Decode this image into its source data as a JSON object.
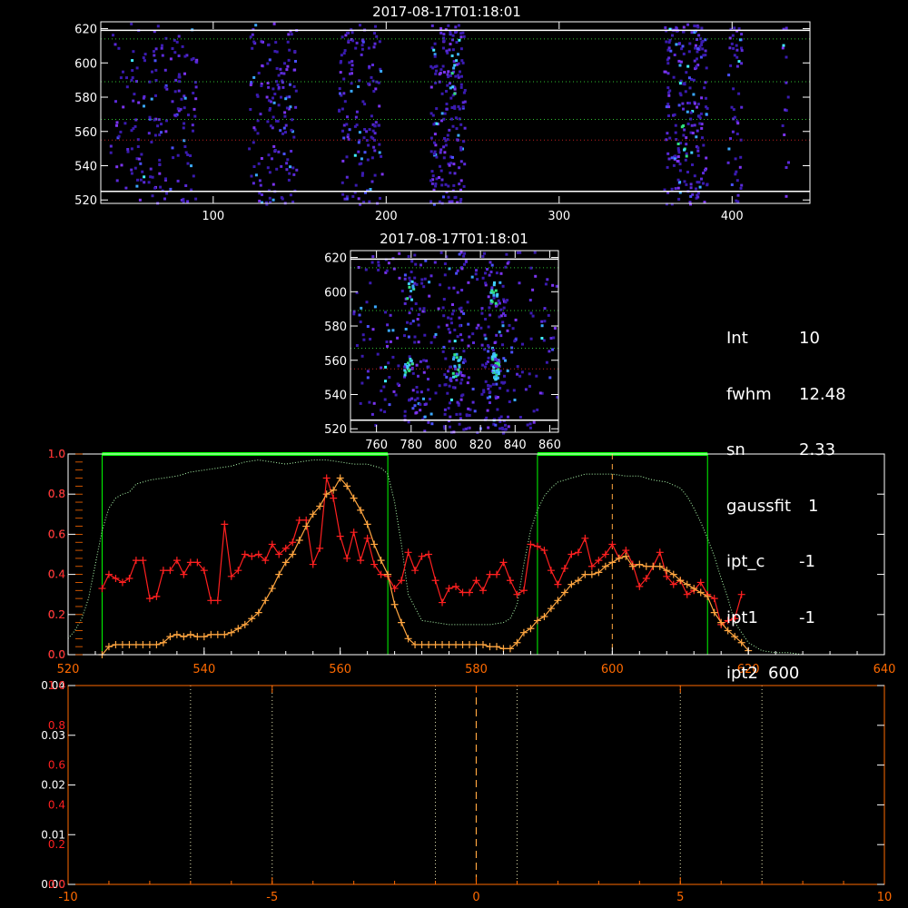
{
  "panels": {
    "top": {
      "title": "2017-08-17T01:18:01",
      "xlim": [
        35,
        445
      ],
      "ylim": [
        518,
        624
      ],
      "xticks": [
        "100",
        "200",
        "300",
        "400"
      ],
      "yticks": [
        "520",
        "540",
        "560",
        "580",
        "600",
        "620"
      ],
      "dotted_lines_y": [
        614,
        589,
        567
      ],
      "red_dotted_line_y": 555,
      "white_lines_y": [
        619,
        525
      ]
    },
    "mid": {
      "title": "2017-08-17T01:18:01",
      "xlim": [
        745,
        865
      ],
      "ylim": [
        518,
        624
      ],
      "xticks": [
        "760",
        "780",
        "800",
        "820",
        "840",
        "860"
      ],
      "yticks": [
        "520",
        "540",
        "560",
        "580",
        "600",
        "620"
      ],
      "dotted_lines_y": [
        614,
        589,
        567
      ],
      "red_dotted_line_y": 555,
      "white_lines_y": [
        619,
        525
      ]
    }
  },
  "info": [
    {
      "key": "Int",
      "value": "10"
    },
    {
      "key": "fwhm",
      "value": "12.48"
    },
    {
      "key": "sn",
      "value": "2.33"
    },
    {
      "key": "gaussfit",
      "value": "1"
    },
    {
      "key": "ipt_c",
      "value": "-1"
    },
    {
      "key": "ipt1",
      "value": "-1"
    },
    {
      "key": "ipt2",
      "value": "600"
    }
  ],
  "colors": {
    "red": "#ff2020",
    "orange": "#ffa640",
    "green": "#00ff00",
    "axis_orange": "#ff6a00",
    "cyan": "#40f0ff",
    "purple": "#5a2ad8"
  },
  "chart_data": [
    {
      "type": "line",
      "xlim": [
        520,
        640
      ],
      "ylim": [
        0,
        1.0
      ],
      "xticks": [
        "520",
        "540",
        "560",
        "580",
        "600",
        "620",
        "640"
      ],
      "yticks_left_white": [
        "0.0",
        "0.2",
        "0.4",
        "0.6",
        "0.8",
        "1.0"
      ],
      "yticks_left_red": [
        "0.0",
        "0.2",
        "0.4",
        "0.6",
        "0.8",
        "1.0"
      ],
      "green_windows": [
        [
          525,
          567
        ],
        [
          589,
          614
        ]
      ],
      "dashed_line_x": 600,
      "series": [
        {
          "x": [
            525,
            526,
            527,
            528,
            529,
            530,
            531,
            532,
            533,
            534,
            535,
            536,
            537,
            538,
            539,
            540,
            541,
            542,
            543,
            544,
            545,
            546,
            547,
            548,
            549,
            550,
            551,
            552,
            553,
            554,
            555,
            556,
            557,
            558,
            559,
            560,
            561,
            562,
            563,
            564,
            565,
            566,
            567,
            568,
            569,
            570,
            571,
            572,
            573,
            574,
            575,
            576,
            577,
            578,
            579,
            580,
            581,
            582,
            583,
            584,
            585,
            586,
            587,
            588,
            589,
            590,
            591,
            592,
            593,
            594,
            595,
            596,
            597,
            598,
            599,
            600,
            601,
            602,
            603,
            604,
            605,
            606,
            607,
            608,
            609,
            610,
            611,
            612,
            613,
            614,
            615,
            616,
            617,
            618,
            619
          ],
          "y": [
            0.33,
            0.4,
            0.38,
            0.36,
            0.38,
            0.47,
            0.47,
            0.28,
            0.29,
            0.42,
            0.42,
            0.47,
            0.4,
            0.46,
            0.46,
            0.42,
            0.27,
            0.27,
            0.65,
            0.39,
            0.42,
            0.5,
            0.49,
            0.5,
            0.47,
            0.55,
            0.5,
            0.53,
            0.56,
            0.67,
            0.67,
            0.45,
            0.53,
            0.88,
            0.78,
            0.59,
            0.48,
            0.61,
            0.47,
            0.58,
            0.45,
            0.4,
            0.39,
            0.33,
            0.37,
            0.51,
            0.42,
            0.49,
            0.5,
            0.37,
            0.26,
            0.33,
            0.34,
            0.31,
            0.31,
            0.37,
            0.32,
            0.4,
            0.4,
            0.46,
            0.37,
            0.3,
            0.32,
            0.55,
            0.54,
            0.52,
            0.42,
            0.35,
            0.43,
            0.5,
            0.51,
            0.58,
            0.44,
            0.47,
            0.5,
            0.55,
            0.48,
            0.52,
            0.45,
            0.34,
            0.38,
            0.44,
            0.51,
            0.39,
            0.35,
            0.37,
            0.3,
            0.32,
            0.36,
            0.3,
            0.28,
            0.15,
            0.17,
            0.18,
            0.3
          ]
        },
        {
          "x": [
            525,
            526,
            527,
            528,
            529,
            530,
            531,
            532,
            533,
            534,
            535,
            536,
            537,
            538,
            539,
            540,
            541,
            542,
            543,
            544,
            545,
            546,
            547,
            548,
            549,
            550,
            551,
            552,
            553,
            554,
            555,
            556,
            557,
            558,
            559,
            560,
            561,
            562,
            563,
            564,
            565,
            566,
            567,
            568,
            569,
            570,
            571,
            572,
            573,
            574,
            575,
            576,
            577,
            578,
            579,
            580,
            581,
            582,
            583,
            584,
            585,
            586,
            587,
            588,
            589,
            590,
            591,
            592,
            593,
            594,
            595,
            596,
            597,
            598,
            599,
            600,
            601,
            602,
            603,
            604,
            605,
            606,
            607,
            608,
            609,
            610,
            611,
            612,
            613,
            614,
            615,
            616,
            617,
            618,
            619,
            620
          ],
          "y": [
            0.0,
            0.04,
            0.05,
            0.05,
            0.05,
            0.05,
            0.05,
            0.05,
            0.05,
            0.06,
            0.09,
            0.1,
            0.09,
            0.1,
            0.09,
            0.09,
            0.1,
            0.1,
            0.1,
            0.11,
            0.13,
            0.15,
            0.18,
            0.21,
            0.27,
            0.33,
            0.4,
            0.46,
            0.5,
            0.57,
            0.64,
            0.7,
            0.74,
            0.8,
            0.82,
            0.88,
            0.84,
            0.78,
            0.72,
            0.65,
            0.55,
            0.47,
            0.4,
            0.25,
            0.16,
            0.08,
            0.05,
            0.05,
            0.05,
            0.05,
            0.05,
            0.05,
            0.05,
            0.05,
            0.05,
            0.05,
            0.05,
            0.04,
            0.04,
            0.03,
            0.03,
            0.06,
            0.11,
            0.13,
            0.17,
            0.19,
            0.23,
            0.27,
            0.31,
            0.35,
            0.37,
            0.4,
            0.4,
            0.41,
            0.44,
            0.46,
            0.48,
            0.49,
            0.44,
            0.45,
            0.44,
            0.44,
            0.44,
            0.42,
            0.4,
            0.37,
            0.35,
            0.33,
            0.31,
            0.29,
            0.21,
            0.16,
            0.12,
            0.09,
            0.06,
            0.02
          ]
        },
        {
          "x": [
            520,
            521,
            522,
            523,
            524,
            525,
            526,
            527,
            528,
            529,
            530,
            532,
            534,
            536,
            538,
            540,
            542,
            544,
            546,
            548,
            550,
            552,
            554,
            556,
            558,
            560,
            562,
            564,
            566,
            567,
            568,
            569,
            570,
            572,
            574,
            576,
            578,
            580,
            582,
            584,
            585,
            586,
            587,
            588,
            589,
            590,
            591,
            592,
            594,
            596,
            598,
            600,
            602,
            604,
            606,
            608,
            610,
            611,
            612,
            613,
            614,
            615,
            616,
            617,
            618,
            620,
            622,
            624,
            626,
            628,
            630,
            632,
            634,
            636,
            638,
            640
          ],
          "y": [
            0.08,
            0.12,
            0.18,
            0.28,
            0.45,
            0.62,
            0.73,
            0.78,
            0.8,
            0.81,
            0.85,
            0.87,
            0.88,
            0.89,
            0.91,
            0.92,
            0.93,
            0.94,
            0.96,
            0.97,
            0.96,
            0.95,
            0.96,
            0.97,
            0.97,
            0.96,
            0.95,
            0.95,
            0.93,
            0.9,
            0.76,
            0.55,
            0.3,
            0.17,
            0.16,
            0.15,
            0.15,
            0.15,
            0.15,
            0.16,
            0.18,
            0.25,
            0.45,
            0.62,
            0.72,
            0.79,
            0.83,
            0.86,
            0.88,
            0.9,
            0.9,
            0.9,
            0.89,
            0.89,
            0.87,
            0.86,
            0.83,
            0.79,
            0.73,
            0.66,
            0.58,
            0.49,
            0.38,
            0.28,
            0.16,
            0.06,
            0.02,
            0.01,
            0.01,
            0.0,
            0.0,
            0.0,
            0.0,
            0.0,
            0.0,
            0.0
          ]
        }
      ]
    },
    {
      "type": "line",
      "xlim": [
        -10,
        10
      ],
      "xticks": [
        "-10",
        "-5",
        "0",
        "5",
        "10"
      ],
      "yticks_left_white": [
        "0.00",
        "0.01",
        "0.02",
        "0.03",
        "0.04"
      ],
      "yticks_left_red": [
        "0.0",
        "0.2",
        "0.4",
        "0.6",
        "0.8",
        "1.0"
      ],
      "dotted_lines_x": [
        -7,
        -5,
        -1,
        1,
        5,
        7
      ],
      "dashed_line_x": 0,
      "series": []
    }
  ]
}
